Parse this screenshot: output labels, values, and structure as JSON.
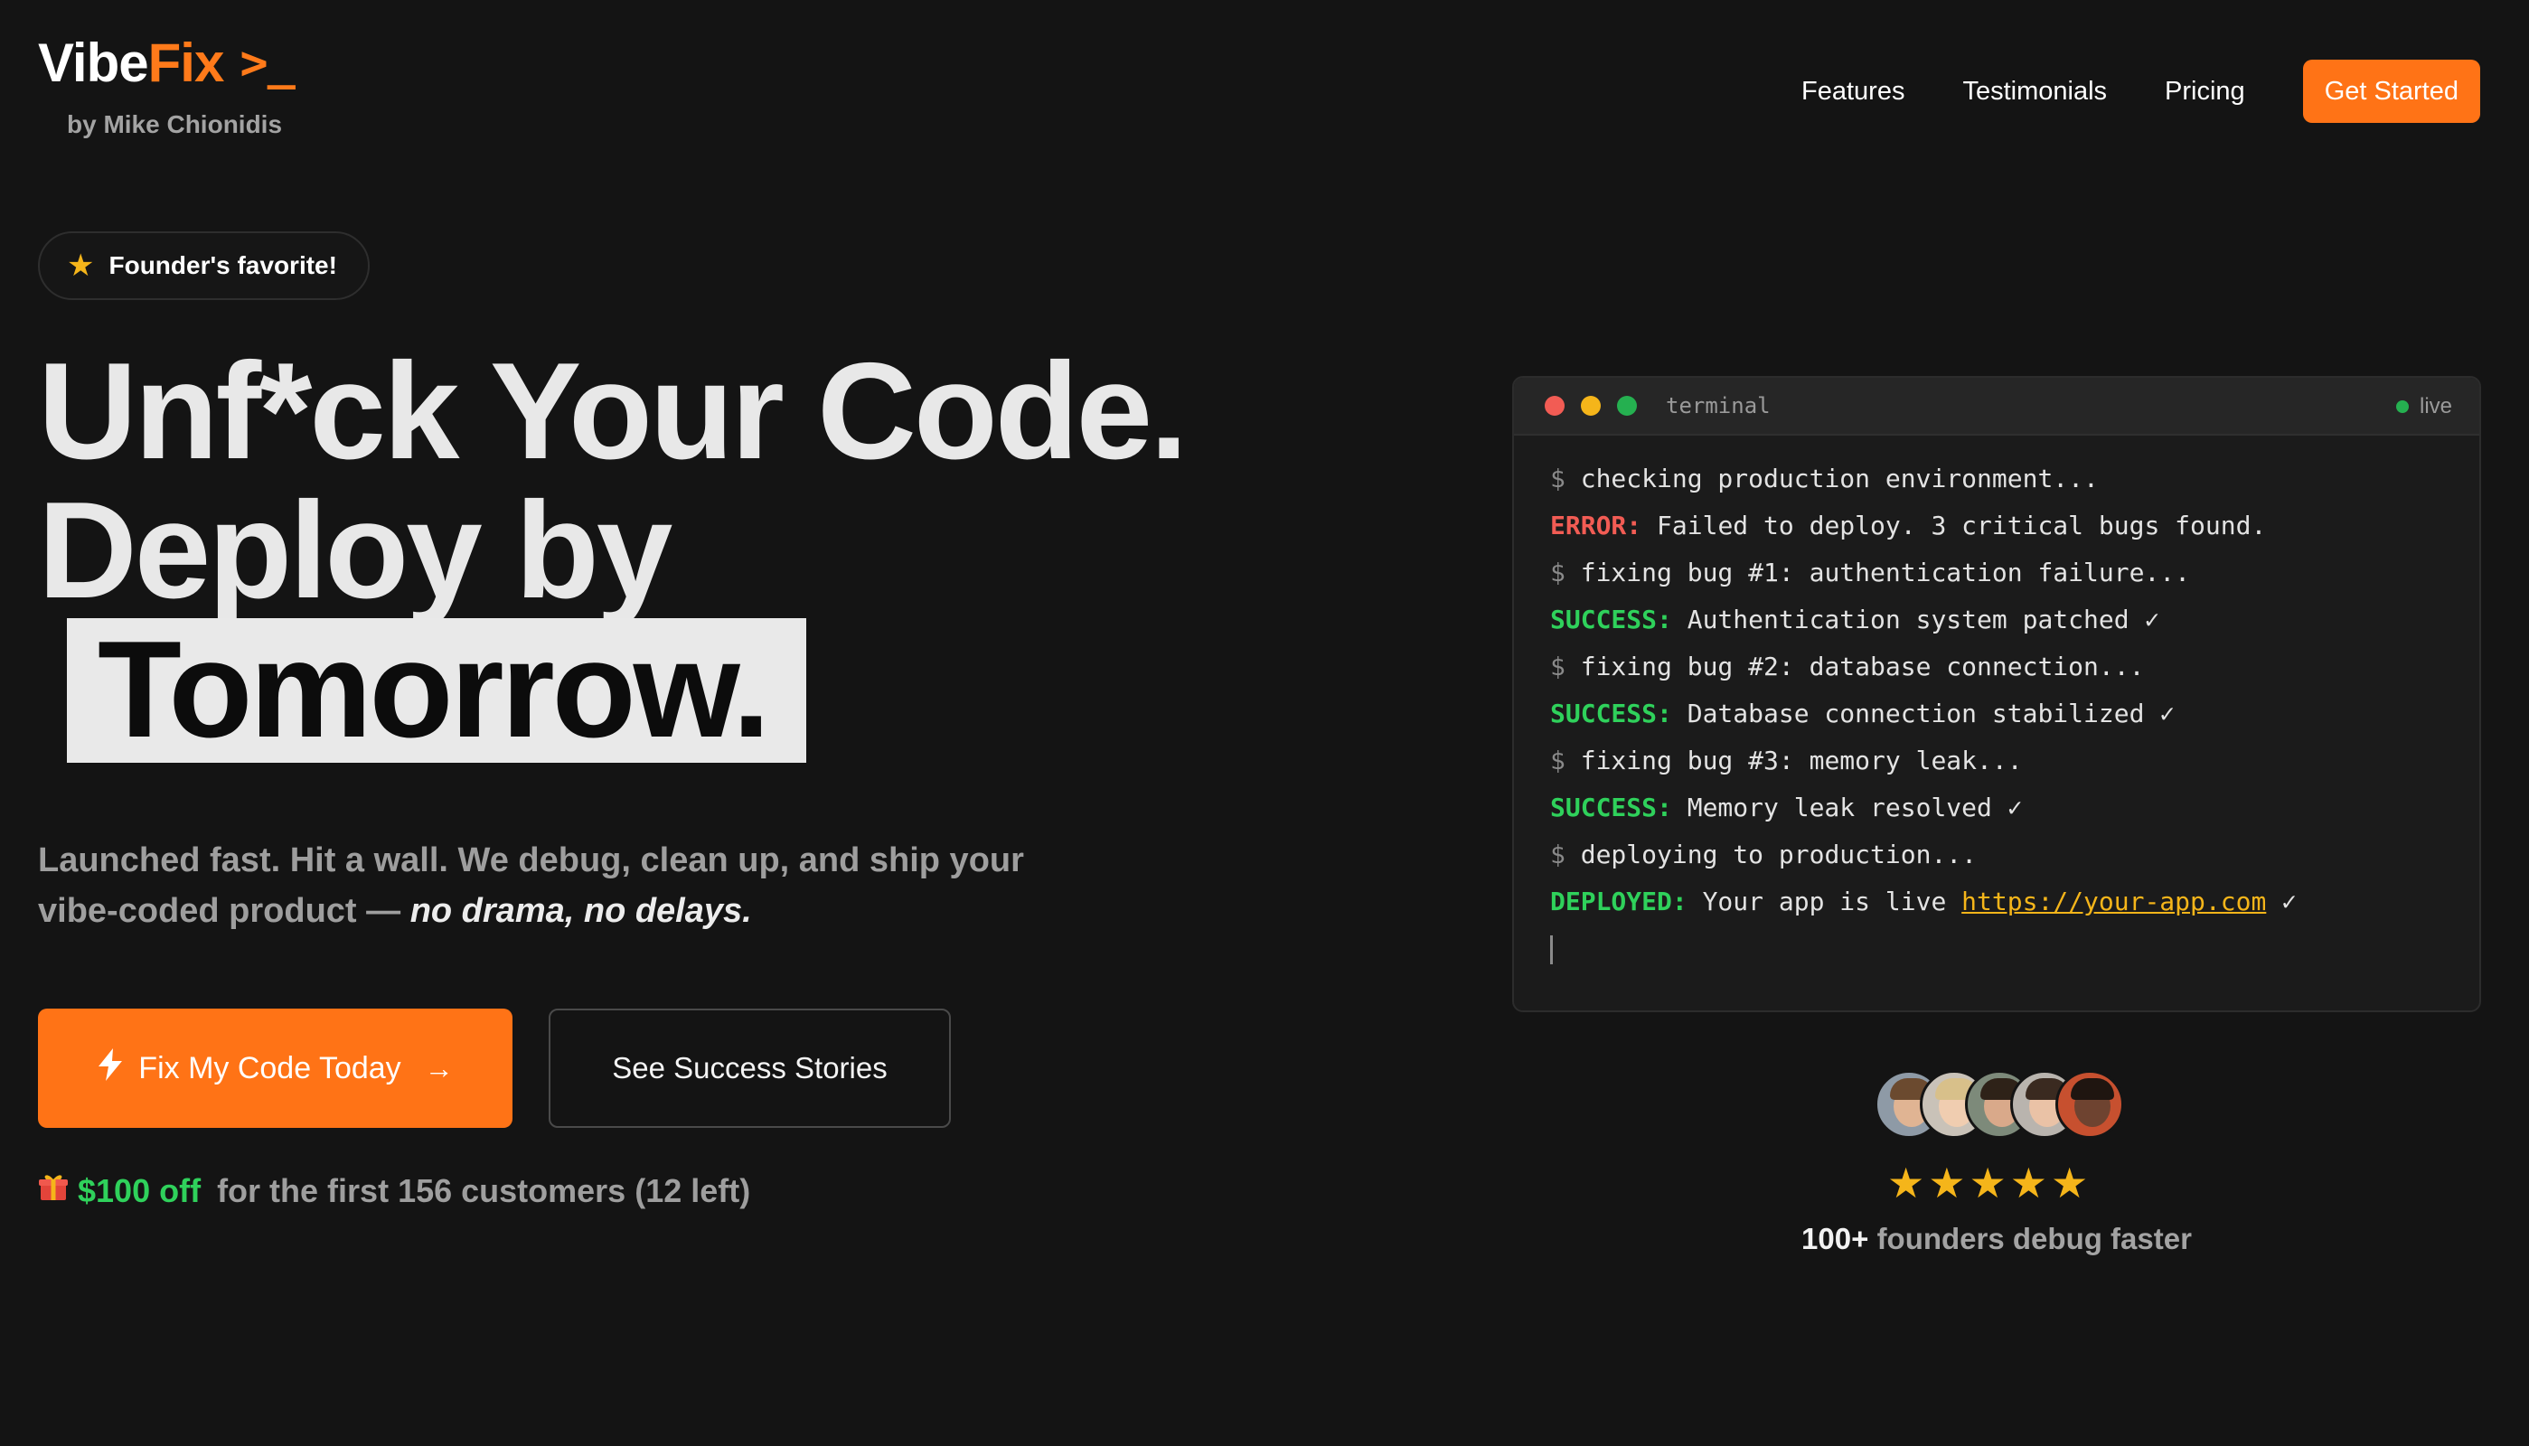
{
  "header": {
    "logo_part1": "Vibe",
    "logo_part2": "Fix",
    "logo_prompt": ">_",
    "byline": "by Mike Chionidis",
    "nav": [
      {
        "label": "Features"
      },
      {
        "label": "Testimonials"
      },
      {
        "label": "Pricing"
      }
    ],
    "cta_label": "Get Started"
  },
  "hero": {
    "badge_icon": "star-icon",
    "badge_text": "Founder's favorite!",
    "headline_line1": "Unf*ck Your Code.",
    "headline_line2": "Deploy by",
    "headline_highlight": "Tomorrow.",
    "subtext_plain": "Launched fast. Hit a wall. We debug, clean up, and ship your vibe-coded product — ",
    "subtext_emphasis": "no drama, no delays.",
    "primary_button": "Fix My Code Today",
    "secondary_button": "See Success Stories",
    "offer_icon": "gift-icon",
    "offer_deal": "$100 off",
    "offer_text": "for the first 156 customers (12 left)"
  },
  "terminal": {
    "title": "terminal",
    "status": "live",
    "lines": [
      {
        "prefix": "$",
        "text": "checking production environment..."
      },
      {
        "tag": "ERROR:",
        "text": "Failed to deploy. 3 critical bugs found."
      },
      {
        "prefix": "$",
        "text": "fixing bug #1: authentication failure..."
      },
      {
        "tag": "SUCCESS:",
        "text": "Authentication system patched ✓"
      },
      {
        "prefix": "$",
        "text": "fixing bug #2: database connection..."
      },
      {
        "tag": "SUCCESS:",
        "text": "Database connection stabilized ✓"
      },
      {
        "prefix": "$",
        "text": "fixing bug #3: memory leak..."
      },
      {
        "tag": "SUCCESS:",
        "text": "Memory leak resolved ✓"
      },
      {
        "prefix": "$",
        "text": "deploying to production..."
      },
      {
        "tag": "DEPLOYED:",
        "text": "Your app is live",
        "url": "https://your-app.com",
        "suffix": "✓"
      }
    ]
  },
  "social_proof": {
    "rating_stars": 5,
    "count": "100+",
    "text": "founders debug faster"
  },
  "colors": {
    "background": "#141414",
    "accent": "#ff7316",
    "success": "#2fd15b",
    "error": "#f25c54",
    "star": "#f5b51a"
  }
}
